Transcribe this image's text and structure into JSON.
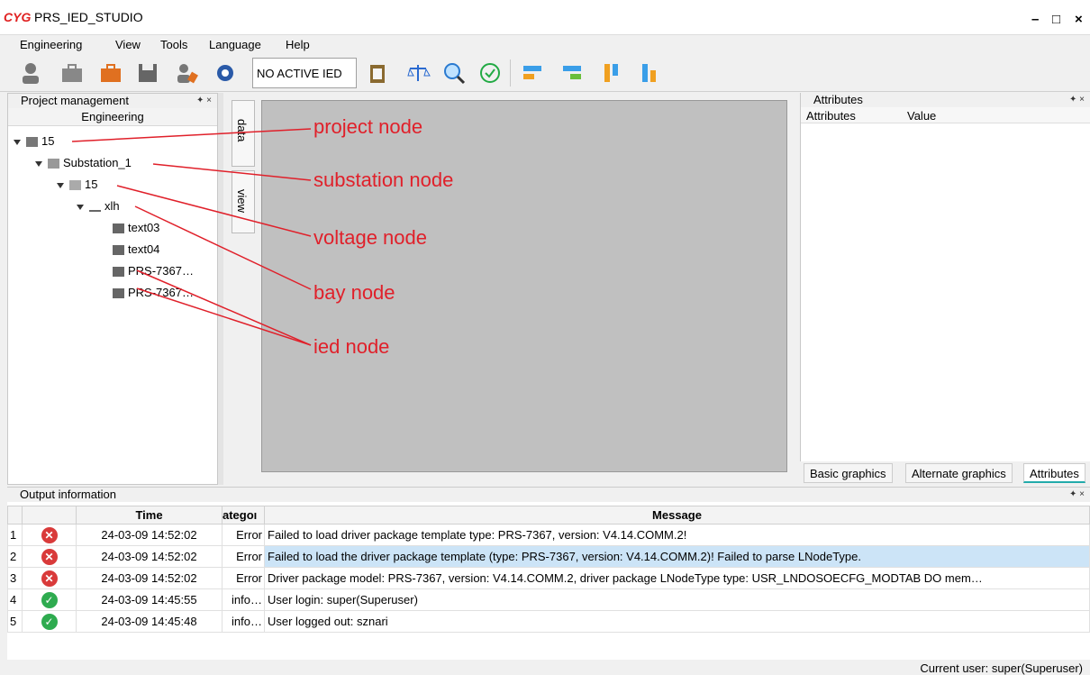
{
  "app": {
    "logo": "CYG",
    "title": "PRS_IED_STUDIO",
    "minimize": "–",
    "maximize": "□",
    "close": "×"
  },
  "menu": [
    "Engineering",
    "View",
    "Tools",
    "Language",
    "Help"
  ],
  "toolbar": {
    "active_ied": "NO ACTIVE IED"
  },
  "left": {
    "header": "Project management",
    "column": "Engineering",
    "tree": {
      "project": "15",
      "substation": "Substation_1",
      "voltage": "15",
      "bay": "xlh",
      "ieds": [
        "text03",
        "text04",
        "PRS-7367…",
        "PRS-7367…"
      ]
    }
  },
  "center": {
    "tabs": [
      "data",
      "view"
    ]
  },
  "annotations": [
    "project node",
    "substation node",
    "voltage node",
    "bay node",
    "ied node"
  ],
  "right": {
    "header": "Attributes",
    "columns": [
      "Attributes",
      "Value"
    ],
    "tabs": [
      "Basic graphics",
      "Alternate graphics",
      "Attributes"
    ]
  },
  "output": {
    "header": "Output information",
    "columns": [
      "Time",
      "ategoı",
      "Message"
    ],
    "rows": [
      {
        "n": "1",
        "status": "error",
        "time": "24-03-09 14:52:02",
        "cat": "Error",
        "msg": "Failed to load driver package template type: PRS-7367, version: V4.14.COMM.2!"
      },
      {
        "n": "2",
        "status": "error",
        "time": "24-03-09 14:52:02",
        "cat": "Error",
        "msg": "Failed to load the driver package template (type: PRS-7367, version: V4.14.COMM.2)! Failed to parse LNodeType."
      },
      {
        "n": "3",
        "status": "error",
        "time": "24-03-09 14:52:02",
        "cat": "Error",
        "msg": "Driver package model: PRS-7367, version: V4.14.COMM.2, driver package LNodeType type: USR_LNDOSOECFG_MODTAB DO mem…"
      },
      {
        "n": "4",
        "status": "ok",
        "time": "24-03-09 14:45:55",
        "cat": "info…",
        "msg": "User login: super(Superuser)"
      },
      {
        "n": "5",
        "status": "ok",
        "time": "24-03-09 14:45:48",
        "cat": "info…",
        "msg": "User logged out: sznari"
      }
    ]
  },
  "status": {
    "current_user": "Current user: super(Superuser)"
  },
  "colors": {
    "annotation": "#e0202a",
    "error": "#d93a3a",
    "ok": "#2eab4f",
    "selected_row": "#cce4f7"
  }
}
